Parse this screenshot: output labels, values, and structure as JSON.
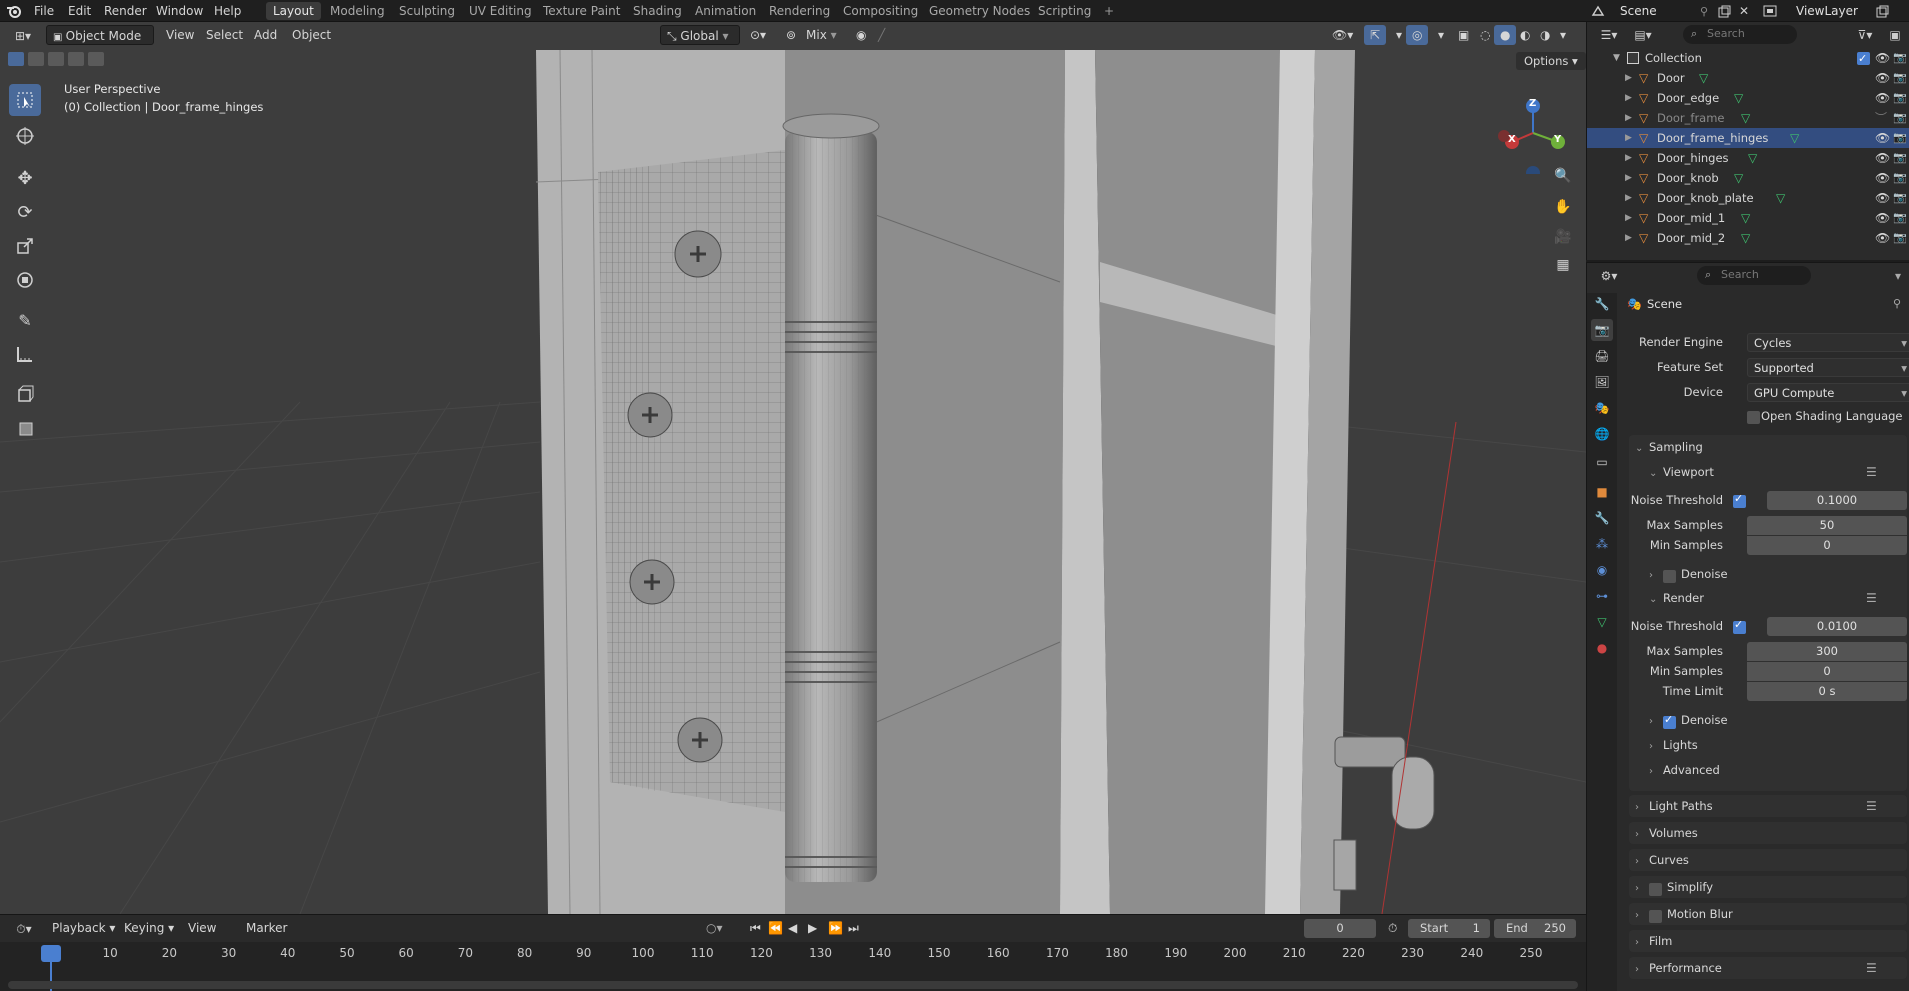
{
  "menu": {
    "file": "File",
    "edit": "Edit",
    "render": "Render",
    "window": "Window",
    "help": "Help"
  },
  "workspaces": [
    "Layout",
    "Modeling",
    "Sculpting",
    "UV Editing",
    "Texture Paint",
    "Shading",
    "Animation",
    "Rendering",
    "Compositing",
    "Geometry Nodes",
    "Scripting"
  ],
  "topright": {
    "scene": "Scene",
    "viewlayer": "ViewLayer"
  },
  "viewport": {
    "mode": "Object Mode",
    "view": "View",
    "select": "Select",
    "add": "Add",
    "object": "Object",
    "transform": "Global",
    "pivot": "Mix",
    "options": "Options",
    "info_line1": "User Perspective",
    "info_line2": "(0) Collection | Door_frame_hinges",
    "gizmo": {
      "x": "X",
      "y": "Y",
      "z": "Z"
    }
  },
  "outliner": {
    "search_placeholder": "Search",
    "collection": "Collection",
    "items": [
      "Door",
      "Door_edge",
      "Door_frame",
      "Door_frame_hinges",
      "Door_hinges",
      "Door_knob",
      "Door_knob_plate",
      "Door_mid_1",
      "Door_mid_2"
    ],
    "selected": "Door_frame_hinges"
  },
  "properties": {
    "search_placeholder": "Search",
    "context": "Scene",
    "render_engine_label": "Render Engine",
    "render_engine": "Cycles",
    "feature_set_label": "Feature Set",
    "feature_set": "Supported",
    "device_label": "Device",
    "device": "GPU Compute",
    "osl_label": "Open Shading Language",
    "sampling": "Sampling",
    "viewport": "Viewport",
    "vp_noise_label": "Noise Threshold",
    "vp_noise": "0.1000",
    "vp_max_label": "Max Samples",
    "vp_max": "50",
    "vp_min_label": "Min Samples",
    "vp_min": "0",
    "denoise": "Denoise",
    "render": "Render",
    "r_noise_label": "Noise Threshold",
    "r_noise": "0.0100",
    "r_max_label": "Max Samples",
    "r_max": "300",
    "r_min_label": "Min Samples",
    "r_min": "0",
    "r_time_label": "Time Limit",
    "r_time": "0 s",
    "r_denoise": "Denoise",
    "lights": "Lights",
    "advanced": "Advanced",
    "light_paths": "Light Paths",
    "volumes": "Volumes",
    "curves": "Curves",
    "simplify": "Simplify",
    "motion_blur": "Motion Blur",
    "film": "Film",
    "performance": "Performance"
  },
  "timeline": {
    "playback": "Playback",
    "keying": "Keying",
    "view": "View",
    "marker": "Marker",
    "current_frame": "0",
    "start_label": "Start",
    "start": "1",
    "end_label": "End",
    "end": "250",
    "ticks": [
      "0",
      "10",
      "20",
      "30",
      "40",
      "50",
      "60",
      "70",
      "80",
      "90",
      "100",
      "110",
      "120",
      "130",
      "140",
      "150",
      "160",
      "170",
      "180",
      "190",
      "200",
      "210",
      "220",
      "230",
      "240",
      "250"
    ]
  },
  "colors": {
    "accent": "#4a7fd0",
    "selected_row": "#334d80",
    "object_icon": "#e08a3c",
    "mesh_icon": "#3fbf6e"
  }
}
